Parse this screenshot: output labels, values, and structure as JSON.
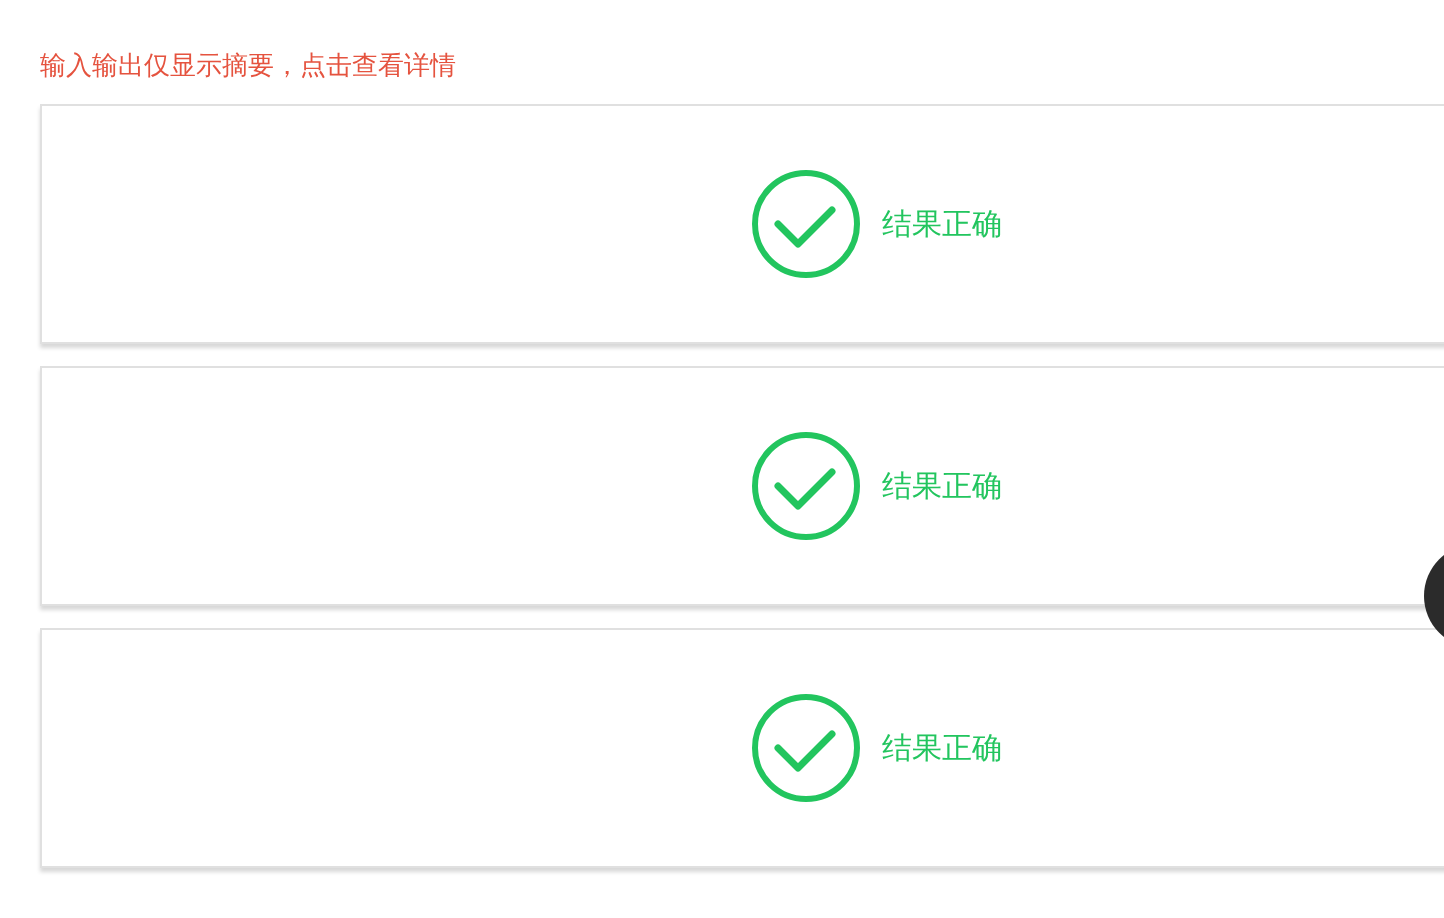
{
  "notice": "输入输出仅显示摘要，点击查看详情",
  "results": [
    {
      "kind": "correct",
      "label": "结果正确"
    },
    {
      "kind": "correct",
      "label": "结果正确"
    },
    {
      "kind": "correct",
      "label": "结果正确"
    }
  ]
}
